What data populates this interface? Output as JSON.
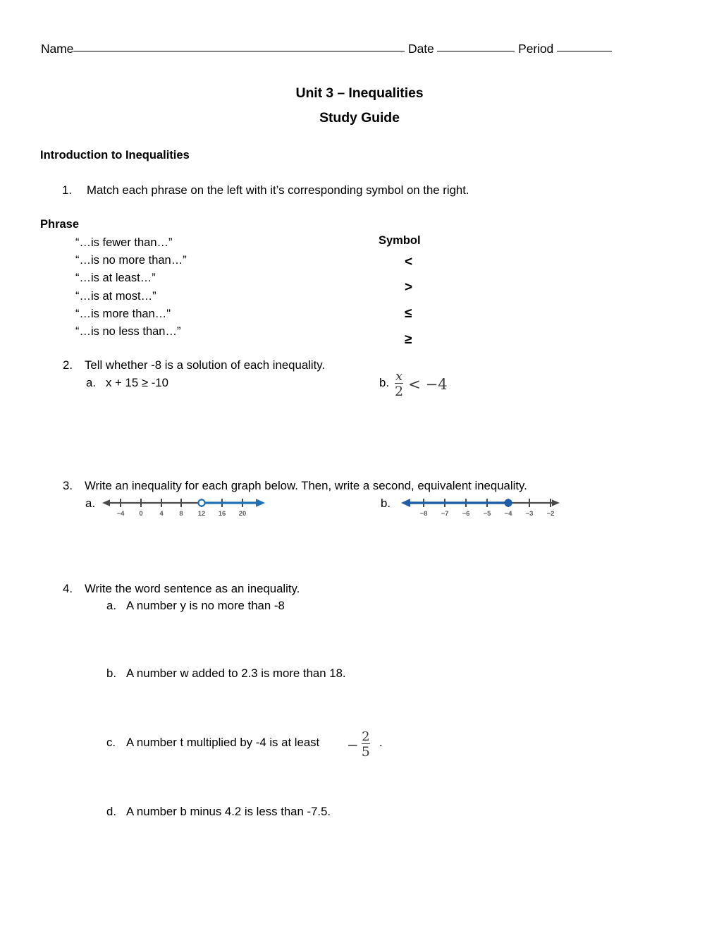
{
  "header": {
    "name_label": "Name",
    "date_label": "Date",
    "period_label": "Period"
  },
  "title": {
    "line1": "Unit 3 – Inequalities",
    "line2": "Study Guide"
  },
  "section_heading": "Introduction to Inequalities",
  "questions": {
    "q1": {
      "marker": "1.",
      "text": "Match each phrase on the left with it’s corresponding symbol on the right.",
      "phrase_header": "Phrase",
      "symbol_header": "Symbol",
      "phrases": [
        "“…is fewer than…”",
        "“…is no more than…”",
        "“…is at least…”",
        "“…is at most…”",
        "“…is more than…\"",
        "“…is no less than…”"
      ],
      "symbols": [
        "<",
        ">",
        "≤",
        "≥"
      ]
    },
    "q2": {
      "marker": "2.",
      "text": "Tell whether -8 is a solution of each inequality.",
      "a": {
        "marker": "a.",
        "text": "x + 15 ≥ -10"
      },
      "b": {
        "marker": "b.",
        "fraction_numerator": "x",
        "fraction_denominator": "2",
        "relation": "<",
        "right_side": "−4"
      }
    },
    "q3": {
      "marker": "3.",
      "text": "Write an inequality for each graph below. Then, write a second, equivalent inequality.",
      "a": {
        "marker": "a.",
        "graph": {
          "tick_labels": [
            "−4",
            "0",
            "4",
            "8",
            "12",
            "16",
            "20"
          ],
          "point_value": "12",
          "point_style": "open",
          "shade_direction": "right",
          "line_color": "#1f6fb5",
          "axis_color": "#4a4a4a"
        }
      },
      "b": {
        "marker": "b.",
        "graph": {
          "tick_labels": [
            "−8",
            "−7",
            "−6",
            "−5",
            "−4",
            "−3",
            "−2"
          ],
          "point_value": "−4",
          "point_style": "closed",
          "shade_direction": "left",
          "line_color": "#1f5fa8",
          "axis_color": "#4a4a4a"
        }
      }
    },
    "q4": {
      "marker": "4.",
      "text": "Write the word sentence as an inequality.",
      "a": {
        "marker": "a.",
        "text": "A number y is no more than -8"
      },
      "b": {
        "marker": "b.",
        "text": "A number w added to 2.3 is more than 18."
      },
      "c": {
        "marker": "c.",
        "text": "A number t multiplied by -4 is at least",
        "fraction_sign": "−",
        "fraction_numerator": "2",
        "fraction_denominator": "5",
        "trailing": "."
      },
      "d": {
        "marker": "d.",
        "text": "A number b minus 4.2 is less than -7.5."
      }
    }
  }
}
